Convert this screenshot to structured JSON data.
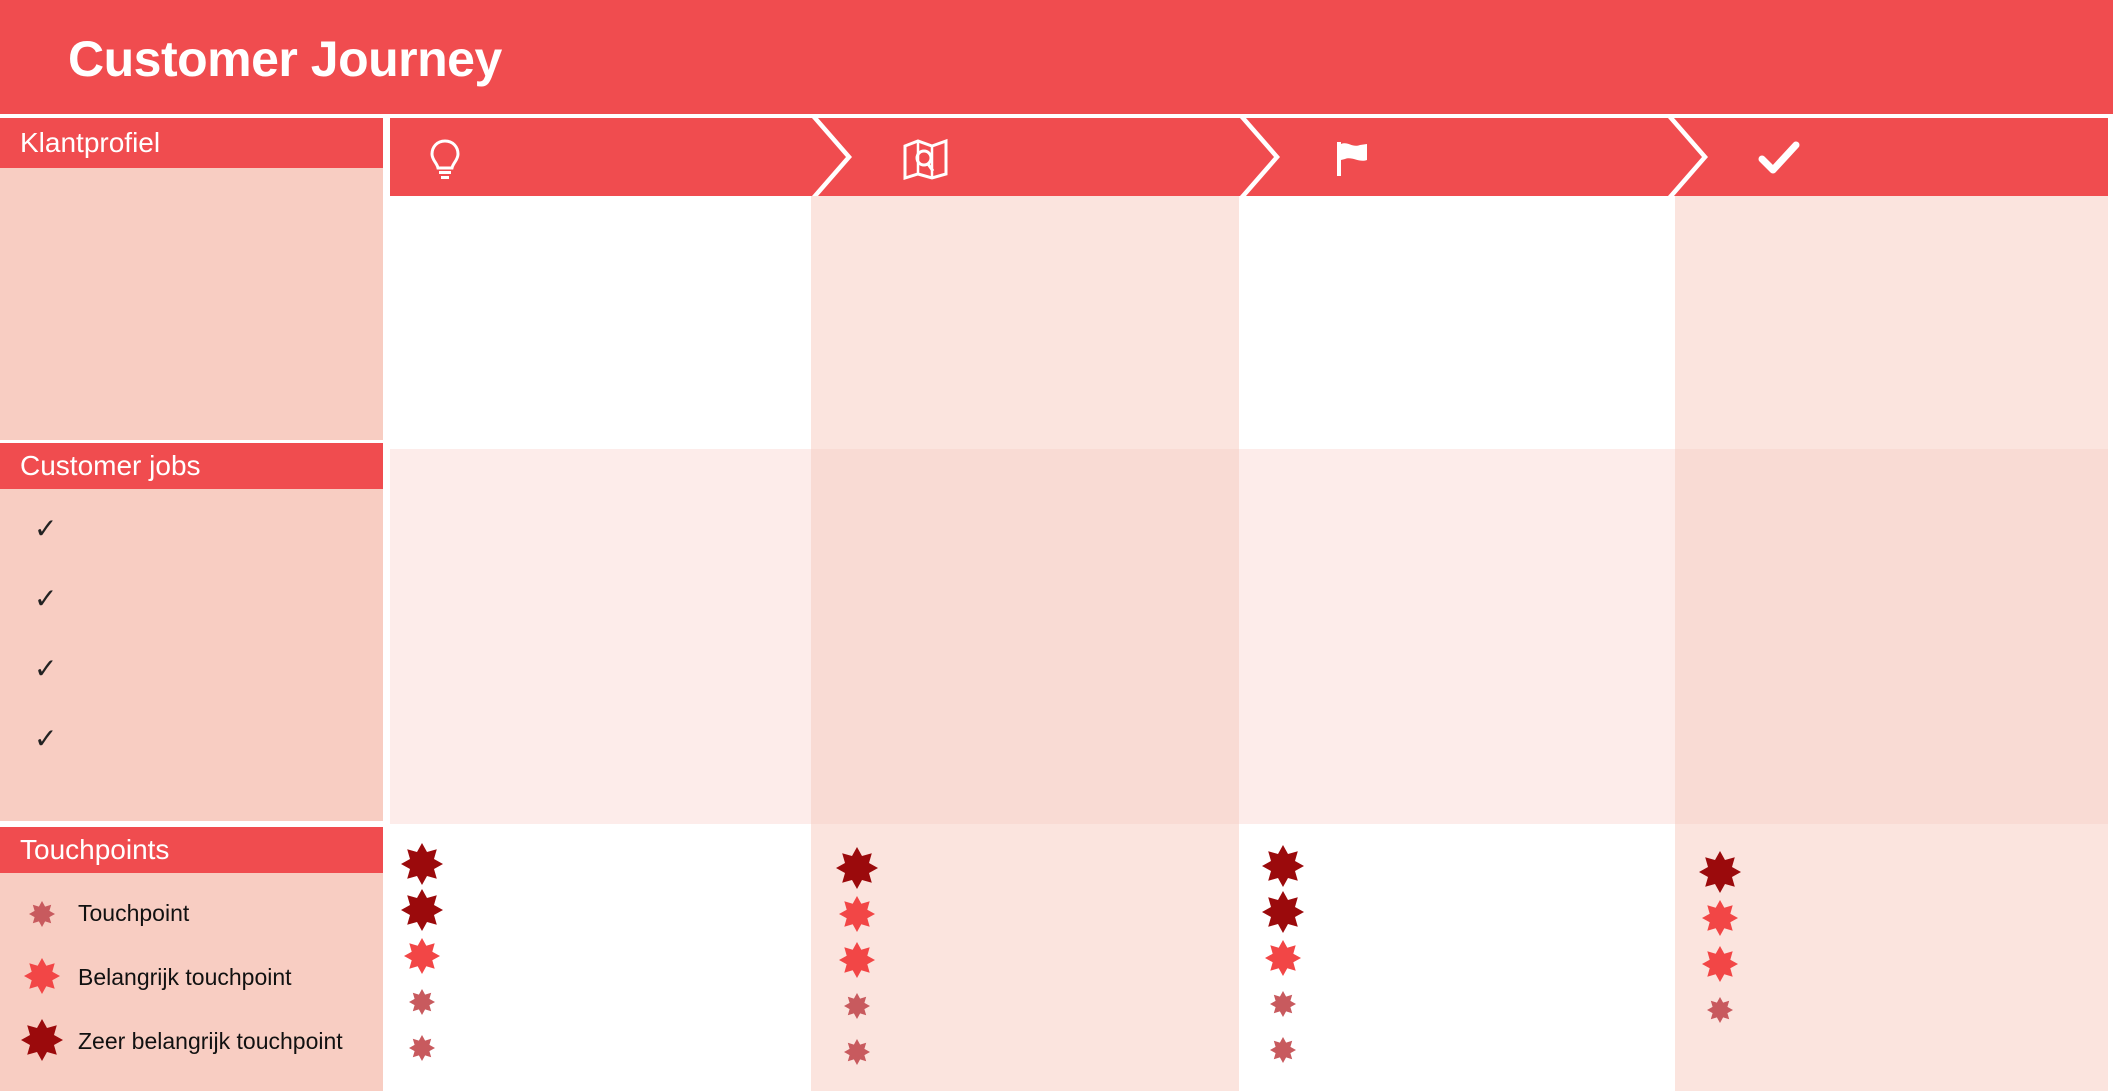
{
  "title": "Customer Journey",
  "colors": {
    "accent": "#f04c4f",
    "sidebar": "#f8cdc2",
    "touchpoint": "#c85a5e",
    "important_touchpoint": "#f24646",
    "very_important_touchpoint": "#9b0a0c"
  },
  "sidebar": {
    "profile_label": "Klantprofiel",
    "jobs_label": "Customer jobs",
    "jobs_checks": [
      "✓",
      "✓",
      "✓",
      "✓"
    ],
    "touchpoints_label": "Touchpoints",
    "legend": [
      {
        "level": "touchpoint",
        "label": "Touchpoint"
      },
      {
        "level": "important",
        "label": "Belangrijk touchpoint"
      },
      {
        "level": "very-important",
        "label": "Zeer belangrijk touchpoint"
      }
    ]
  },
  "phases": [
    {
      "icon": "lightbulb-icon",
      "touchpoints": [
        "very-important",
        "very-important",
        "important",
        "touchpoint",
        "touchpoint"
      ]
    },
    {
      "icon": "map-search-icon",
      "touchpoints": [
        "very-important",
        "important",
        "important",
        "touchpoint",
        "touchpoint"
      ]
    },
    {
      "icon": "flag-icon",
      "touchpoints": [
        "very-important",
        "very-important",
        "important",
        "touchpoint",
        "touchpoint"
      ]
    },
    {
      "icon": "checkmark-icon",
      "touchpoints": [
        "very-important",
        "important",
        "important",
        "touchpoint"
      ]
    }
  ]
}
